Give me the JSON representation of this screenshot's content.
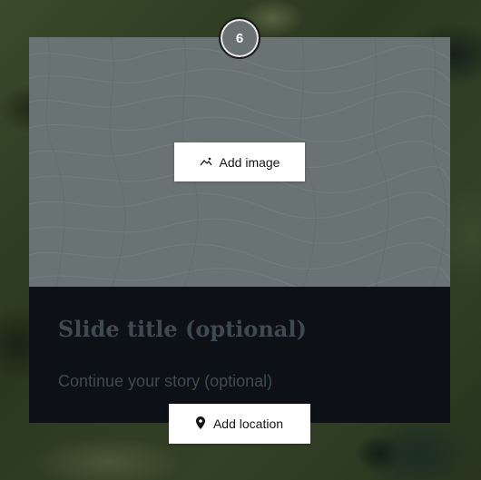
{
  "slide": {
    "number": "6",
    "add_image_label": "Add image",
    "title_placeholder": "Slide title (optional)",
    "body_placeholder": "Continue your story (optional)",
    "add_location_label": "Add location"
  },
  "icons": {
    "image": "image-icon",
    "location": "map-pin-icon"
  },
  "colors": {
    "media_placeholder": "#6a7373",
    "text_panel": "#0d1116",
    "placeholder_text": "#3e4952",
    "button_bg": "#ffffff"
  }
}
